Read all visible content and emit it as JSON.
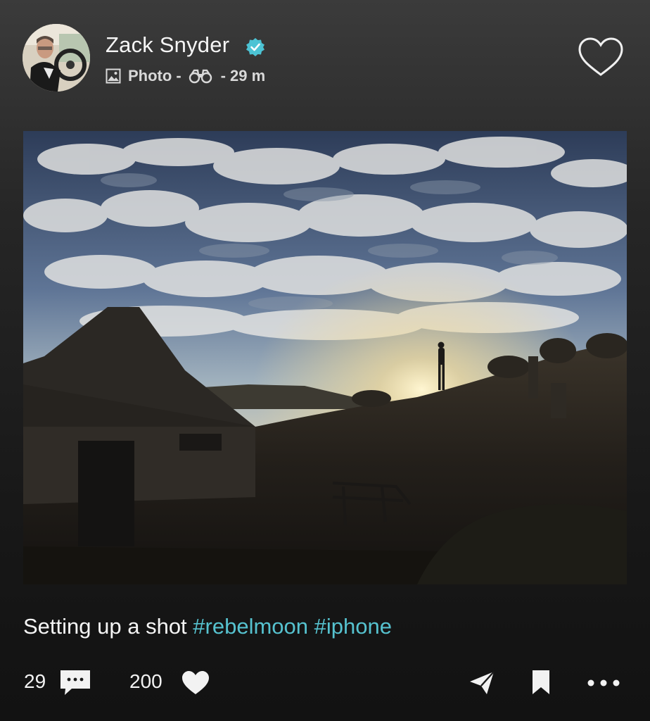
{
  "post": {
    "author": "Zack Snyder",
    "verified_icon": "verified-badge-icon",
    "type_label": "Photo",
    "separator": "-",
    "time_ago": "29 m",
    "caption_text": "Setting up a shot",
    "hashtags": [
      "#rebelmoon",
      "#iphone"
    ]
  },
  "actions": {
    "comment_count": "29",
    "like_count": "200"
  },
  "icons": {
    "photo": "image-icon",
    "audience": "binoculars-icon",
    "favorite": "heart-outline-icon",
    "comment": "speech-bubble-icon",
    "like": "heart-filled-icon",
    "share": "paper-plane-icon",
    "save": "bookmark-icon",
    "more": "more-dots-icon"
  },
  "colors": {
    "hashtag": "#56c2cf",
    "verified": "#4cc3d4",
    "text": "#f5f5f5"
  }
}
